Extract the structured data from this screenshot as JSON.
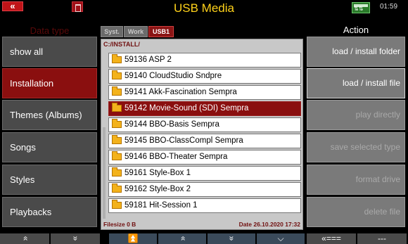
{
  "header": {
    "back_icon": "«",
    "title": "USB Media",
    "clock": "01:59"
  },
  "left_panel": {
    "title": "Data type",
    "items": [
      {
        "label": "show all"
      },
      {
        "label": "Installation"
      },
      {
        "label": "Themes (Albums)"
      },
      {
        "label": "Songs"
      },
      {
        "label": "Styles"
      },
      {
        "label": "Playbacks"
      }
    ]
  },
  "file_browser": {
    "tabs": [
      {
        "label": "Syst."
      },
      {
        "label": "Work"
      },
      {
        "label": "USB1"
      }
    ],
    "path": "C:/INSTALL/",
    "files": [
      {
        "name": "59136 ASP 2"
      },
      {
        "name": "59140 CloudStudio Sndpre"
      },
      {
        "name": "59141 Akk-Fascination Sempra"
      },
      {
        "name": "59142 Movie-Sound (SDI) Sempra"
      },
      {
        "name": "59144 BBO-Basis Sempra"
      },
      {
        "name": "59145 BBO-ClassCompl Sempra"
      },
      {
        "name": "59146 BBO-Theater Sempra"
      },
      {
        "name": "59161 Style-Box 1"
      },
      {
        "name": "59162 Style-Box 2"
      },
      {
        "name": "59181 Hit-Session 1"
      }
    ],
    "selected_index": 3,
    "filesize": "Filesize 0 B",
    "date": "Date 26.10.2020  17:32"
  },
  "right_panel": {
    "title": "Action",
    "actions": [
      {
        "label": "load / install folder"
      },
      {
        "label": "load / install file"
      },
      {
        "label": "play directly"
      },
      {
        "label": "save selected type"
      },
      {
        "label": "format drive"
      },
      {
        "label": "delete file"
      }
    ]
  },
  "bottom_bar": {
    "buttons": [
      {
        "label": "»"
      },
      {
        "label": "»"
      },
      {
        "label": "⏫"
      },
      {
        "label": "»"
      },
      {
        "label": "»"
      },
      {
        "label": "⌵"
      },
      {
        "label": "«==="
      },
      {
        "label": "---"
      }
    ]
  },
  "colors": {
    "accent": "#ffd21a",
    "selected": "#8a0f0f",
    "button": "#4a4a4a",
    "action": "#7a7a7a"
  }
}
